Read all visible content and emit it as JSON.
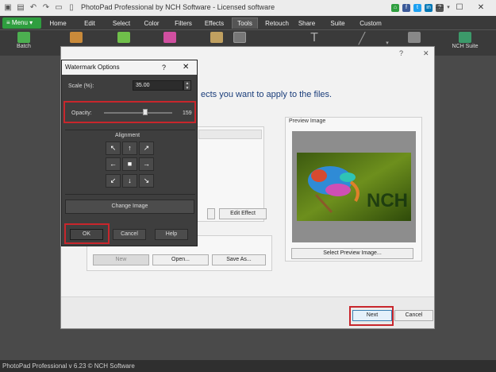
{
  "window": {
    "title": "PhotoPad Professional by NCH Software - Licensed software",
    "minimize": "—",
    "maximize": "☐",
    "close": "✕"
  },
  "menubar": {
    "menu_label": "≡ Menu ▾",
    "tabs": [
      "Home",
      "Edit",
      "Select",
      "Color",
      "Filters",
      "Effects",
      "Tools",
      "Retouch",
      "Share",
      "Suite",
      "Custom"
    ]
  },
  "toolbar": {
    "batch_label": "Batch",
    "nch_suite_label": "NCH Suite"
  },
  "wizard": {
    "instruction": "ects you want to apply to the files.",
    "edit_effect_label": "Edit Effect",
    "preview_title": "Preview Image",
    "select_preview_label": "Select Preview Image...",
    "new_label": "New",
    "open_label": "Open...",
    "save_as_label": "Save As...",
    "next_label": "Next",
    "cancel_label": "Cancel",
    "help_glyph": "?",
    "close_glyph": "✕",
    "watermark_text": "NCH"
  },
  "watermark_dialog": {
    "title": "Watermark Options",
    "help_glyph": "?",
    "close_glyph": "✕",
    "scale_label": "Scale (%):",
    "scale_value": "35.00",
    "opacity_label": "Opacity:",
    "opacity_value": "159",
    "alignment_label": "Alignment",
    "arrows": [
      "↖",
      "↑",
      "↗",
      "←",
      "■",
      "→",
      "↙",
      "↓",
      "↘"
    ],
    "change_image_label": "Change Image",
    "ok_label": "OK",
    "cancel_label": "Cancel",
    "help_label": "Help"
  },
  "status": {
    "text": "PhotoPad Professional v 6.23 © NCH Software"
  },
  "colors": {
    "accent_green": "#2f9e3f",
    "highlight_red": "#c8262c",
    "instruction_blue": "#1a3d7a"
  }
}
